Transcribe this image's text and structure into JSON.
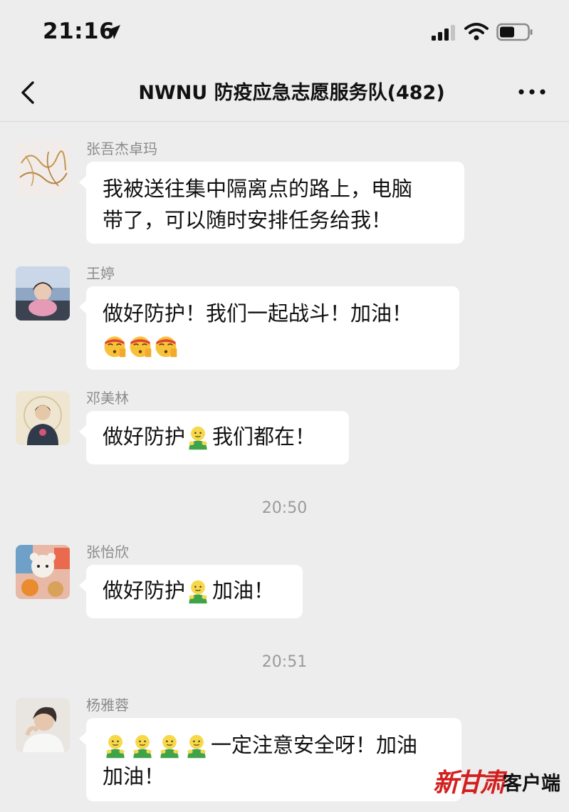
{
  "status_bar": {
    "time": "21:16"
  },
  "nav": {
    "title": "NWNU 防疫应急志愿服务队(482)"
  },
  "messages": [
    {
      "sender": "张吾杰卓玛",
      "line1": "我被送往集中隔离点的路上，电脑",
      "line2": "带了，可以随时安排任务给我！"
    },
    {
      "sender": "王婷",
      "line1": "做好防护！我们一起战斗！加油！"
    },
    {
      "sender": "邓美林",
      "text_before": "做好防护",
      "text_after": "我们都在！"
    },
    {
      "sender": "张怡欣",
      "text_before": "做好防护",
      "text_after": "加油！"
    },
    {
      "sender": "杨雅蓉",
      "line1_after": "一定注意安全呀！加油",
      "line2": "加油！"
    }
  ],
  "timestamps": [
    "20:50",
    "20:51"
  ],
  "icons": {
    "salute_emoji": "saluting-face-icon",
    "hug_emoji": "green-hug-emoji-icon"
  },
  "watermark": {
    "brand": "新甘肃",
    "label": "客户端"
  },
  "colors": {
    "bubble": "#ffffff",
    "background": "#ededed",
    "brand_red": "#d21f1f"
  }
}
